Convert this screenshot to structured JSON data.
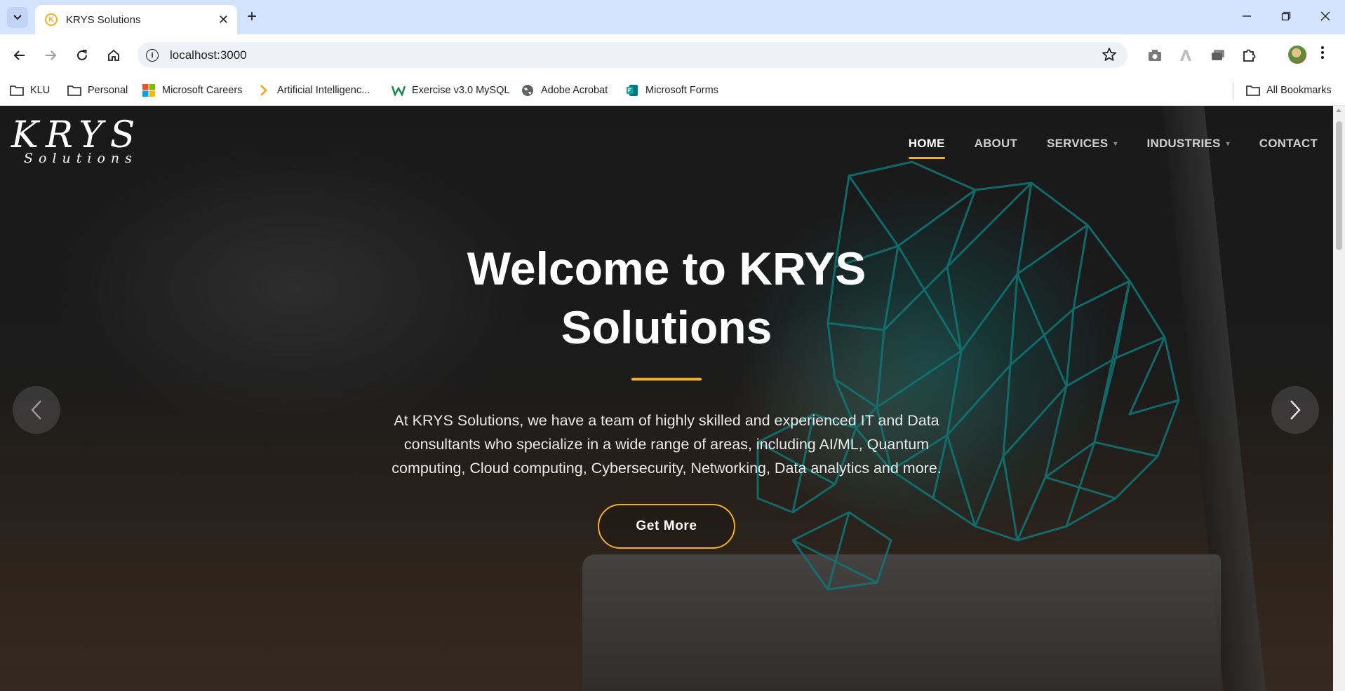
{
  "browser": {
    "tab_title": "KRYS Solutions",
    "url": "localhost:3000",
    "tab_close": "✕",
    "new_tab": "+"
  },
  "bookmarks": [
    {
      "label": "KLU",
      "icon": "folder-icon"
    },
    {
      "label": "Personal",
      "icon": "folder-icon"
    },
    {
      "label": "Microsoft Careers",
      "icon": "microsoft-logo-icon"
    },
    {
      "label": "Artificial Intelligenc...",
      "icon": "chevron-right-icon"
    },
    {
      "label": "Exercise v3.0 MySQL",
      "icon": "w-logo-icon"
    },
    {
      "label": "Adobe Acrobat",
      "icon": "globe-icon"
    },
    {
      "label": "Microsoft Forms",
      "icon": "forms-icon"
    }
  ],
  "all_bookmarks": "All Bookmarks",
  "site": {
    "logo_main": "KRYS",
    "logo_sub": "Solutions",
    "nav": [
      {
        "label": "HOME",
        "active": true
      },
      {
        "label": "ABOUT"
      },
      {
        "label": "SERVICES",
        "dropdown": true
      },
      {
        "label": "INDUSTRIES",
        "dropdown": true
      },
      {
        "label": "CONTACT"
      }
    ],
    "hero": {
      "title_line1": "Welcome to KRYS",
      "title_line2": "Solutions",
      "text": "At KRYS Solutions, we have a team of highly skilled and experienced IT and Data consultants who specialize in a wide range of areas, including AI/ML, Quantum computing, Cloud computing, Cybersecurity, Networking, Data analytics and more.",
      "cta": "Get More"
    }
  },
  "colors": {
    "accent": "#f3b01c",
    "chrome_tabstrip": "#d3e3fd",
    "mesh": "#17a3a3"
  }
}
